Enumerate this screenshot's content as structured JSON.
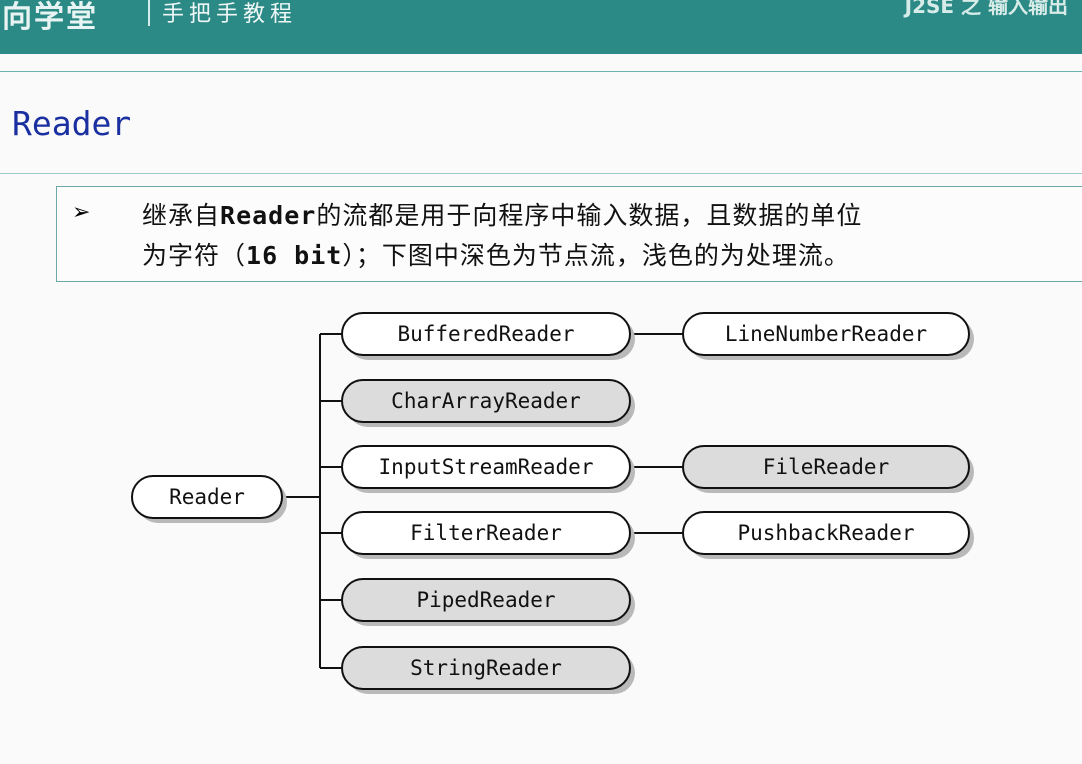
{
  "header": {
    "logo": "向学堂",
    "subtitle": "手把手教程",
    "corner": "J2SE 之 输入输出"
  },
  "slide": {
    "title": "Reader",
    "bullet": {
      "line1_a": "继承自",
      "line1_b": "Reader",
      "line1_c": "的流都是用于向程序中输入数据，且数据的单位",
      "line2_a": "为字符（",
      "line2_b": "16 bit",
      "line2_c": "）；下图中深色为节点流，浅色的为处理流。"
    }
  },
  "diagram": {
    "root": {
      "label": "Reader",
      "style": "light"
    },
    "children": [
      {
        "label": "BufferedReader",
        "style": "light",
        "child": {
          "label": "LineNumberReader",
          "style": "light"
        }
      },
      {
        "label": "CharArrayReader",
        "style": "dark"
      },
      {
        "label": "InputStreamReader",
        "style": "light",
        "child": {
          "label": "FileReader",
          "style": "dark"
        }
      },
      {
        "label": "FilterReader",
        "style": "light",
        "child": {
          "label": "PushbackReader",
          "style": "light"
        }
      },
      {
        "label": "PipedReader",
        "style": "dark"
      },
      {
        "label": "StringReader",
        "style": "dark"
      }
    ],
    "colors": {
      "light_fill": "#ffffff",
      "dark_fill": "#dcdcdc",
      "stroke": "#111111",
      "shadow": "#b9b9b9"
    }
  }
}
